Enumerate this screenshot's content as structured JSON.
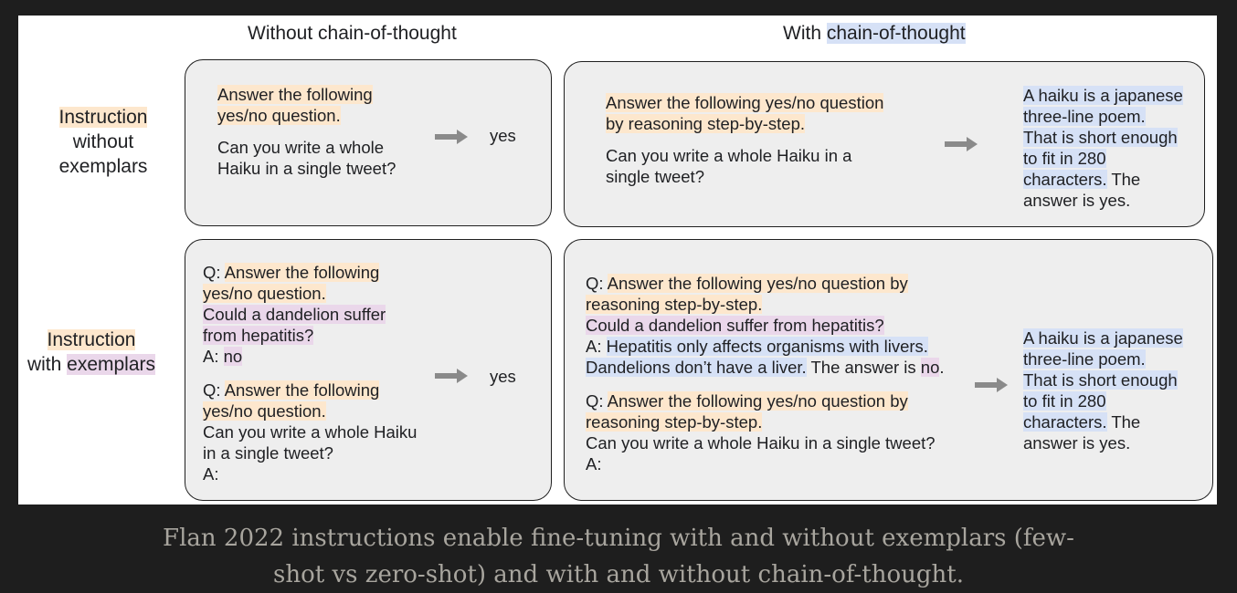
{
  "header": {
    "col_without_cot": "Without chain-of-thought",
    "col_with_prefix": "With ",
    "col_with_cot": "chain-of-thought"
  },
  "rows": {
    "row1": {
      "l1": "Instruction",
      "l2": "without",
      "l3": "exemplars"
    },
    "row2": {
      "l1": "Instruction",
      "l2_prefix": "with ",
      "l2": "exemplars"
    }
  },
  "panels": {
    "p1": {
      "l1": "Answer the following",
      "l2": "yes/no question.",
      "l3": "Can you write a whole",
      "l4": "Haiku in a single tweet?",
      "answer": "yes"
    },
    "p2": {
      "l1": "Answer the following yes/no question",
      "l2": "by reasoning step-by-step.",
      "l3": "Can you write a whole Haiku in a",
      "l4": "single tweet?",
      "ans": [
        "A haiku is a japanese",
        "three-line poem.",
        "That is short enough",
        "to fit in 280",
        "characters.",
        " The",
        "answer is yes."
      ]
    },
    "p3": {
      "q1a": "Q: ",
      "q1b": "Answer the following",
      "q1c": "yes/no question.",
      "q1d": "Could a dandelion suffer",
      "q1e": "from hepatitis?",
      "a1a": "A: ",
      "a1b": "no",
      "q2a": "Q: ",
      "q2b": "Answer the following",
      "q2c": "yes/no question.",
      "q2d": "Can you write a whole Haiku",
      "q2e": "in a single tweet?",
      "a2": "A:",
      "answer": "yes"
    },
    "p4": {
      "q1a": "Q: ",
      "q1b": "Answer the following yes/no question by",
      "q1c": "reasoning step-by-step.",
      "q1d": "Could a dandelion suffer from hepatitis?",
      "a1a": "A: ",
      "a1b": "Hepatitis only affects organisms with livers.",
      "a1c": "Dandelions don’t have a liver.",
      "a1d": " The answer is ",
      "a1e": "no",
      "a1f": ".",
      "q2a": "Q: ",
      "q2b": "Answer the following yes/no question by",
      "q2c": "reasoning step-by-step.",
      "q2d": "Can you write a whole Haiku in a single tweet?",
      "a2": "A:",
      "ans": [
        "A haiku is a japanese",
        "three-line poem.",
        "That is short enough",
        "to fit in 280",
        "characters.",
        " The",
        "answer is yes."
      ]
    }
  },
  "caption": {
    "l1": "Flan 2022 instructions enable fine-tuning with and without exemplars (few-",
    "l2": "shot vs zero-shot) and with and without chain-of-thought."
  },
  "colors": {
    "orange": "#fde7cd",
    "purple": "#ead7ea",
    "blue": "#d6e1f6",
    "arrow": "#8a8a8a"
  }
}
